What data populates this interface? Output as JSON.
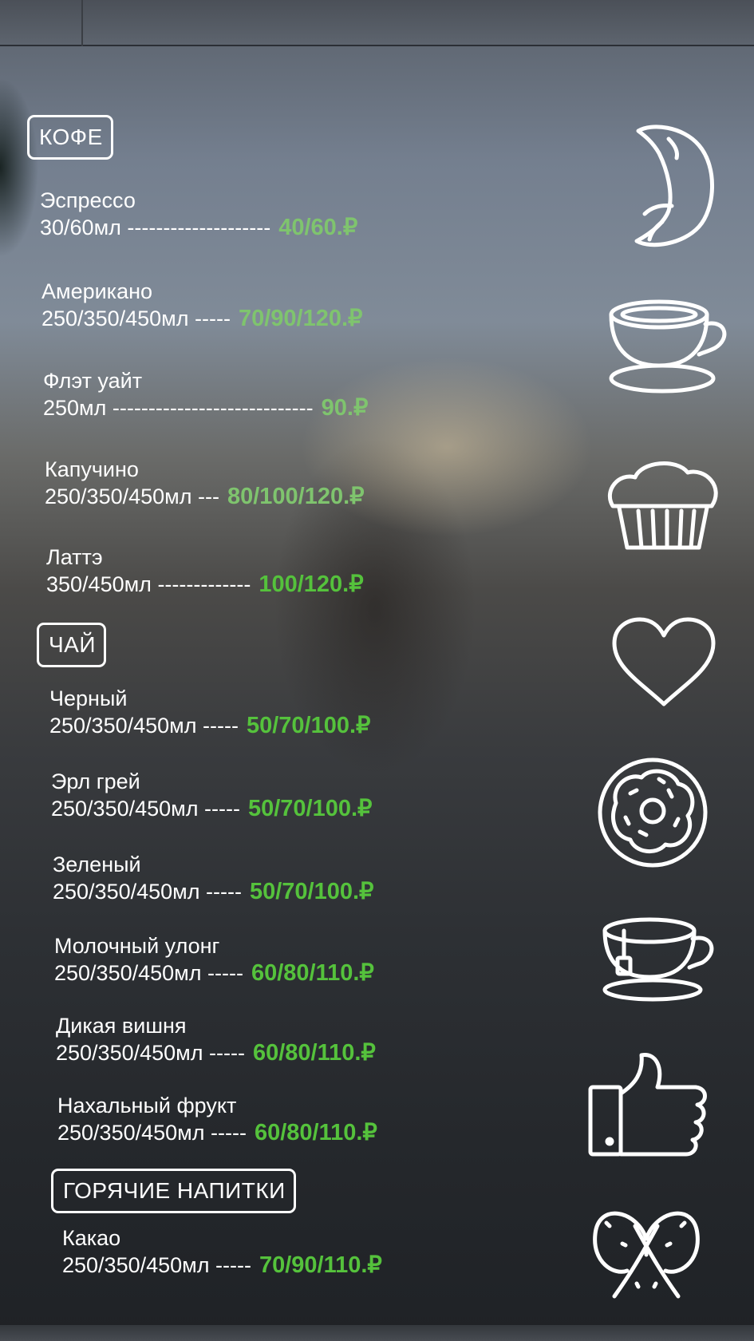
{
  "colors": {
    "text": "#ffffff",
    "price_green": "#55c23c",
    "price_green_faded": "#7fc46e"
  },
  "sections": [
    {
      "title": "КОФЕ",
      "items": [
        {
          "name": "Эспрессо",
          "size": "30/60мл",
          "dashes": "--------------------",
          "price": "40/60.₽"
        },
        {
          "name": "Американо",
          "size": "250/350/450мл",
          "dashes": "-----",
          "price": "70/90/120.₽"
        },
        {
          "name": "Флэт уайт",
          "size": "250мл",
          "dashes": "----------------------------",
          "price": "90.₽"
        },
        {
          "name": "Капучино",
          "size": "250/350/450мл",
          "dashes": "---",
          "price": "80/100/120.₽"
        },
        {
          "name": "Латтэ",
          "size": "350/450мл",
          "dashes": "-------------",
          "price": "100/120.₽"
        }
      ]
    },
    {
      "title": "ЧАЙ",
      "items": [
        {
          "name": "Черный",
          "size": "250/350/450мл",
          "dashes": "-----",
          "price": "50/70/100.₽"
        },
        {
          "name": "Эрл грей",
          "size": "250/350/450мл",
          "dashes": "-----",
          "price": "50/70/100.₽"
        },
        {
          "name": "Зеленый",
          "size": "250/350/450мл",
          "dashes": "-----",
          "price": "50/70/100.₽"
        },
        {
          "name": "Молочный улонг",
          "size": "250/350/450мл",
          "dashes": "-----",
          "price": "60/80/110.₽"
        },
        {
          "name": "Дикая вишня",
          "size": "250/350/450мл",
          "dashes": "-----",
          "price": "60/80/110.₽"
        },
        {
          "name": "Нахальный фрукт",
          "size": "250/350/450мл",
          "dashes": "-----",
          "price": "60/80/110.₽"
        }
      ]
    },
    {
      "title": "ГОРЯЧИЕ НАПИТКИ",
      "items": [
        {
          "name": "Какао",
          "size": "250/350/450мл",
          "dashes": "-----",
          "price": "70/90/110.₽"
        }
      ]
    }
  ],
  "icons": [
    "croissant-icon",
    "coffee-cup-icon",
    "muffin-icon",
    "heart-icon",
    "donut-icon",
    "tea-cup-icon",
    "thumbs-up-icon",
    "pretzel-icon"
  ]
}
